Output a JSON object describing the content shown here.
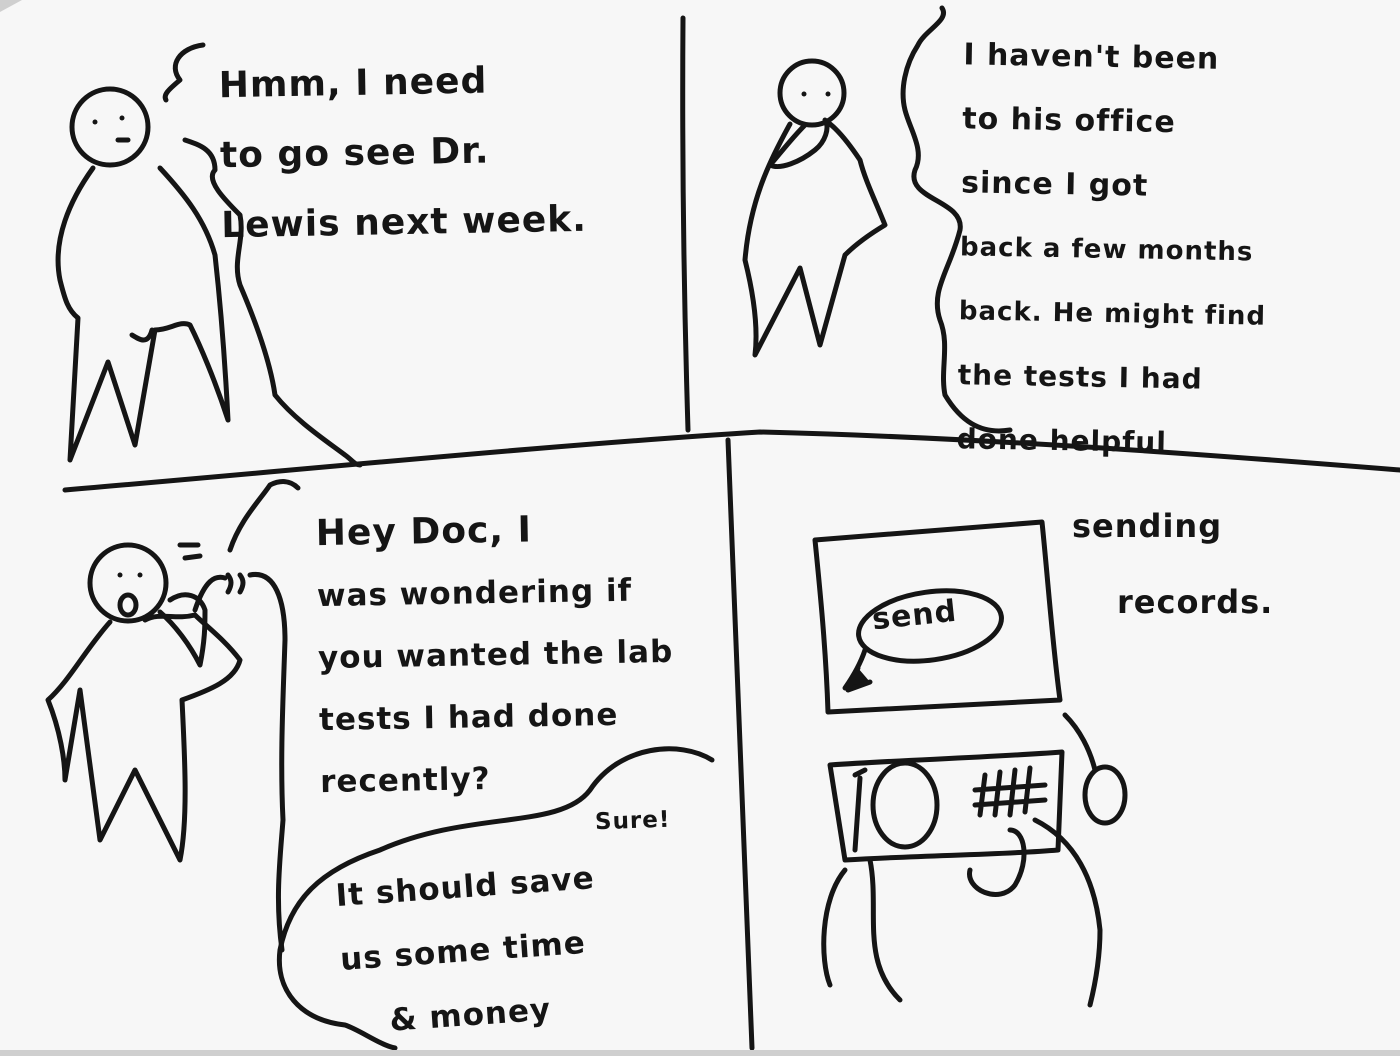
{
  "comic": {
    "panel_1": {
      "speech_lines": [
        "Hmm, I need",
        "to go see Dr.",
        "Lewis next week."
      ]
    },
    "panel_2": {
      "thought_lines": [
        "I haven't been",
        "to his office",
        "since I got",
        "back a few months",
        "back. He might find",
        "the tests I had",
        "done helpful"
      ]
    },
    "panel_3": {
      "speech_lines": [
        "Hey Doc, I",
        "was wondering if",
        "you wanted the lab",
        "tests I had done",
        "recently?"
      ],
      "reply_intro": "Sure!",
      "reply_lines": [
        "It should save",
        "us some time",
        "& money"
      ]
    },
    "panel_4": {
      "caption_lines": [
        "sending",
        "records."
      ],
      "screen_button_label": "send"
    }
  },
  "colors": {
    "paper": "#f7f7f7",
    "ink": "#151515",
    "shadow": "#cfcfcf"
  }
}
